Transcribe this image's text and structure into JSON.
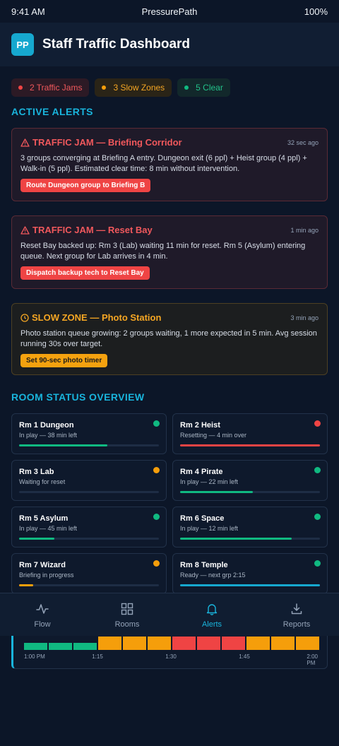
{
  "status_bar": {
    "time": "9:41 AM",
    "app": "PressurePath",
    "battery": "100%"
  },
  "header": {
    "logo": "PP",
    "title": "Staff Traffic Dashboard"
  },
  "summary": [
    {
      "label": "2 Traffic Jams",
      "tone": "red"
    },
    {
      "label": "3 Slow Zones",
      "tone": "amber"
    },
    {
      "label": "5 Clear",
      "tone": "green"
    }
  ],
  "alerts_title": "ACTIVE ALERTS",
  "alerts": [
    {
      "tone": "red",
      "icon": "warning-triangle-icon",
      "title": "TRAFFIC JAM — Briefing Corridor",
      "time": "32 sec ago",
      "body": "3 groups converging at Briefing A entry. Dungeon exit (6 ppl) + Heist group (4 ppl) + Walk-in (5 ppl). Estimated clear time: 8 min without intervention.",
      "action": "Route Dungeon group to Briefing B"
    },
    {
      "tone": "red",
      "icon": "warning-triangle-icon",
      "title": "TRAFFIC JAM — Reset Bay",
      "time": "1 min ago",
      "body": "Reset Bay backed up: Rm 3 (Lab) waiting 11 min for reset. Rm 5 (Asylum) entering queue. Next group for Lab arrives in 4 min.",
      "action": "Dispatch backup tech to Reset Bay"
    },
    {
      "tone": "amber",
      "icon": "clock-icon",
      "title": "SLOW ZONE — Photo Station",
      "time": "3 min ago",
      "body": "Photo station queue growing: 2 groups waiting, 1 more expected in 5 min. Avg session running 30s over target.",
      "action": "Set 90-sec photo timer"
    }
  ],
  "rooms_title": "ROOM STATUS OVERVIEW",
  "rooms": [
    {
      "name": "Rm 1 Dungeon",
      "status": "In play — 38 min left",
      "indicator": "#10b981",
      "progress": 0.63,
      "bar_color": "#10b981"
    },
    {
      "name": "Rm 2 Heist",
      "status": "Resetting — 4 min over",
      "indicator": "#ef4444",
      "progress": 1.0,
      "bar_color": "#ef4444"
    },
    {
      "name": "Rm 3 Lab",
      "status": "Waiting for reset",
      "indicator": "#f59e0b",
      "progress": 0.0,
      "bar_color": "#f59e0b"
    },
    {
      "name": "Rm 4 Pirate",
      "status": "In play — 22 min left",
      "indicator": "#10b981",
      "progress": 0.52,
      "bar_color": "#10b981"
    },
    {
      "name": "Rm 5 Asylum",
      "status": "In play — 45 min left",
      "indicator": "#10b981",
      "progress": 0.25,
      "bar_color": "#10b981"
    },
    {
      "name": "Rm 6 Space",
      "status": "In play — 12 min left",
      "indicator": "#10b981",
      "progress": 0.8,
      "bar_color": "#10b981"
    },
    {
      "name": "Rm 7 Wizard",
      "status": "Briefing in progress",
      "indicator": "#f59e0b",
      "progress": 0.1,
      "bar_color": "#f59e0b"
    },
    {
      "name": "Rm 8 Temple",
      "status": "Ready — next grp 2:15",
      "indicator": "#10b981",
      "progress": 1.0,
      "bar_color": "#16a8cf"
    }
  ],
  "timeline": {
    "levels": [
      "clear",
      "clear",
      "clear",
      "slow",
      "slow",
      "slow",
      "jam",
      "jam",
      "jam",
      "slow",
      "slow",
      "slow"
    ],
    "colors": {
      "clear": "#10b981",
      "slow": "#f59e0b",
      "jam": "#ef4444"
    },
    "ticks": [
      "1:00 PM",
      "1:15",
      "1:30",
      "1:45",
      "2:00 PM"
    ]
  },
  "tabs": [
    {
      "label": "Flow",
      "icon": "pulse-icon",
      "active": false
    },
    {
      "label": "Rooms",
      "icon": "grid-icon",
      "active": false
    },
    {
      "label": "Alerts",
      "icon": "bell-icon",
      "active": true
    },
    {
      "label": "Reports",
      "icon": "download-icon",
      "active": false
    }
  ]
}
